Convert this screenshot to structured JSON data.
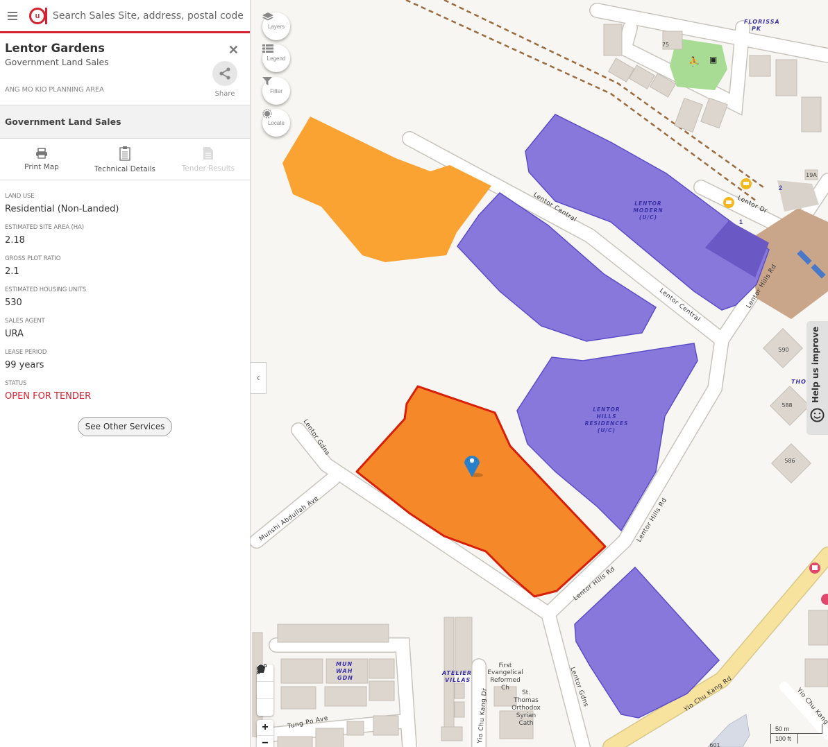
{
  "search": {
    "placeholder": "Search Sales Site, address, postal code"
  },
  "site": {
    "title": "Lentor Gardens",
    "subtitle": "Government Land Sales",
    "planning_area": "ANG MO KIO PLANNING AREA",
    "share_label": "Share"
  },
  "section": {
    "title": "Government Land Sales"
  },
  "actions": [
    {
      "label": "Print Map",
      "icon": "printer-icon",
      "enabled": true
    },
    {
      "label": "Technical Details",
      "icon": "clipboard-icon",
      "enabled": true
    },
    {
      "label": "Tender Results",
      "icon": "document-icon",
      "enabled": false
    }
  ],
  "fields": [
    {
      "label": "Land Use",
      "value": "Residential (Non-Landed)"
    },
    {
      "label": "Estimated Site Area (ha)",
      "value": "2.18"
    },
    {
      "label": "Gross Plot Ratio",
      "value": "2.1"
    },
    {
      "label": "Estimated Housing Units",
      "value": "530"
    },
    {
      "label": "Sales Agent",
      "value": "URA"
    },
    {
      "label": "Lease Period",
      "value": "99 years"
    },
    {
      "label": "Status",
      "value": "OPEN FOR TENDER"
    }
  ],
  "other_services_label": "See Other Services",
  "map": {
    "controls": [
      {
        "label": "Layers",
        "icon": "layers-icon"
      },
      {
        "label": "Legend",
        "icon": "legend-icon"
      },
      {
        "label": "Filter",
        "icon": "filter-icon"
      },
      {
        "label": "Locate",
        "icon": "locate-icon"
      }
    ],
    "help_label": "Help us improve",
    "scale": {
      "metric": "50 m",
      "imperial": "100 ft"
    },
    "zoom_in": "+",
    "zoom_out": "−",
    "colors": {
      "selected_site": "#f5892a",
      "selected_outline": "#d81e05",
      "available_site": "#fba332",
      "awarded_site": "#8878dc",
      "background": "#f8f6f2",
      "status_red": "#d3212f"
    },
    "parcel_labels": [
      {
        "lines": [
          "LENTOR",
          "MODERN",
          "(U/C)"
        ]
      },
      {
        "lines": [
          "LENTOR",
          "HILLS",
          "RESIDENCES",
          "(U/C)"
        ]
      }
    ],
    "estate_labels": [
      "MUN WAH GDN",
      "ATELIER VILLAS",
      "FLORISSA PK",
      "THOM G"
    ],
    "roads": [
      "Lentor Central",
      "Lentor Central",
      "Lentor Dr",
      "Lentor Hills Rd",
      "Lentor Hills Rd",
      "Lentor Hills Rd",
      "Lentor Gdns",
      "Lentor Gdns",
      "Munshi Abdullah Ave",
      "Tung Po Ave",
      "Yio Chu Kang Dr",
      "Yio Chu Kang Rd",
      "Yio Chu Kang Rd"
    ],
    "places": [
      "First Evangelical Reformed Ch",
      "St. Thomas Orthodox Syrian Cath"
    ],
    "building_numbers": [
      "590",
      "588",
      "586",
      "19A",
      "75",
      "601"
    ]
  }
}
